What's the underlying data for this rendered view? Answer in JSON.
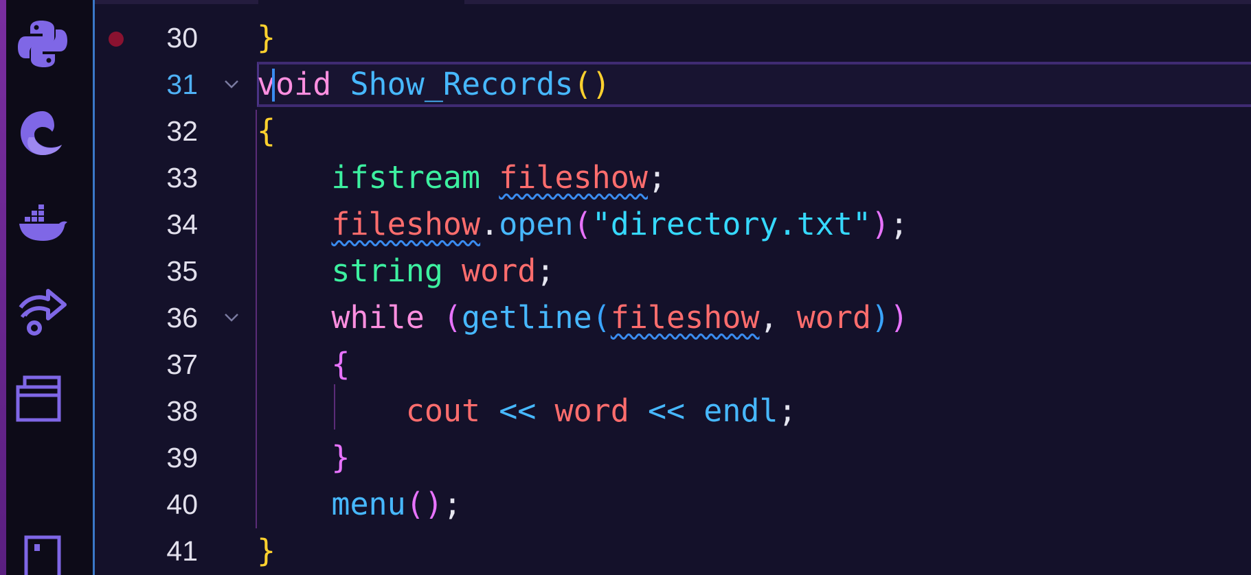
{
  "activity_bar": {
    "icons": [
      "python-icon",
      "edge-icon",
      "docker-icon",
      "remote-share-icon",
      "windows-icon",
      "device-icon"
    ]
  },
  "editor": {
    "lines": [
      {
        "number": "30",
        "active": false,
        "breakpoint": true,
        "fold": false
      },
      {
        "number": "31",
        "active": true,
        "breakpoint": false,
        "fold": true
      },
      {
        "number": "32",
        "active": false,
        "breakpoint": false,
        "fold": false
      },
      {
        "number": "33",
        "active": false,
        "breakpoint": false,
        "fold": false
      },
      {
        "number": "34",
        "active": false,
        "breakpoint": false,
        "fold": false
      },
      {
        "number": "35",
        "active": false,
        "breakpoint": false,
        "fold": false
      },
      {
        "number": "36",
        "active": false,
        "breakpoint": false,
        "fold": true
      },
      {
        "number": "37",
        "active": false,
        "breakpoint": false,
        "fold": false
      },
      {
        "number": "38",
        "active": false,
        "breakpoint": false,
        "fold": false
      },
      {
        "number": "39",
        "active": false,
        "breakpoint": false,
        "fold": false
      },
      {
        "number": "40",
        "active": false,
        "breakpoint": false,
        "fold": false
      },
      {
        "number": "41",
        "active": false,
        "breakpoint": false,
        "fold": false
      }
    ],
    "code": {
      "l30": {
        "brace": "}"
      },
      "l31": {
        "kw": "void",
        "fn": "Show_Records",
        "open": "(",
        "close": ")"
      },
      "l32": {
        "brace": "{"
      },
      "l33": {
        "type": "ifstream",
        "var": "fileshow",
        "semi": ";"
      },
      "l34": {
        "var": "fileshow",
        "dot": ".",
        "fn": "open",
        "open": "(",
        "str": "\"directory.txt\"",
        "close": ")",
        "semi": ";"
      },
      "l35": {
        "type": "string",
        "var": "word",
        "semi": ";"
      },
      "l36": {
        "kw": "while",
        "open1": "(",
        "fn": "getline",
        "open2": "(",
        "arg1": "fileshow",
        "comma": ",",
        "arg2": "word",
        "close2": ")",
        "close1": ")"
      },
      "l37": {
        "brace": "{"
      },
      "l38": {
        "var": "cout",
        "op1": "<<",
        "var2": "word",
        "op2": "<<",
        "fn": "endl",
        "semi": ";"
      },
      "l39": {
        "brace": "}"
      },
      "l40": {
        "fn": "menu",
        "open": "(",
        "close": ")",
        "semi": ";"
      },
      "l41": {
        "brace": "}"
      }
    }
  },
  "colors": {
    "background": "#14112a",
    "keyword": "#ff8fe0",
    "function": "#47b8ff",
    "type": "#3df0a0",
    "variable": "#ff6d6d",
    "string": "#36d9ff",
    "breakpoint": "#8a1230"
  }
}
